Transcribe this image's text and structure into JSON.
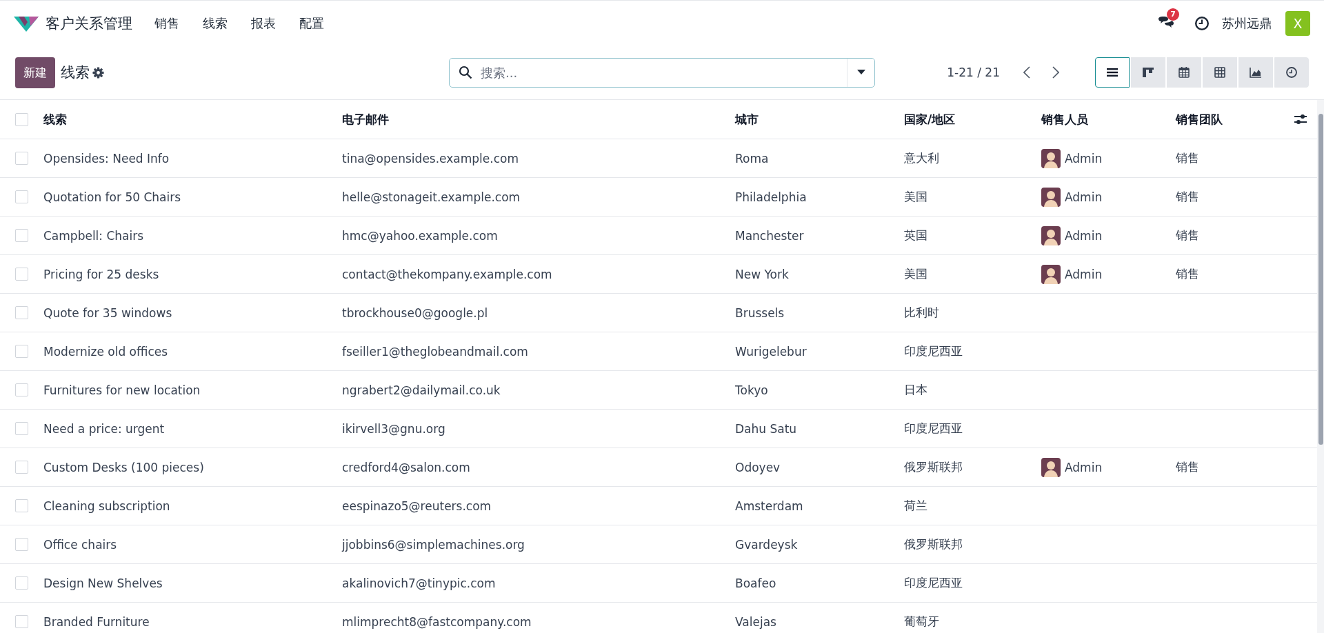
{
  "navbar": {
    "app_name": "客户关系管理",
    "menu": [
      "销售",
      "线索",
      "报表",
      "配置"
    ],
    "messages_badge": "7",
    "company": "苏州远鼎",
    "user_initial": "X"
  },
  "control_panel": {
    "new_button": "新建",
    "breadcrumb": "线索",
    "search": {
      "placeholder": "搜索..."
    },
    "pager": "1-21 / 21",
    "views": [
      {
        "kind": "list",
        "selected": true
      },
      {
        "kind": "kanban",
        "selected": false
      },
      {
        "kind": "calendar",
        "selected": false
      },
      {
        "kind": "pivot",
        "selected": false
      },
      {
        "kind": "graph",
        "selected": false
      },
      {
        "kind": "activity",
        "selected": false
      }
    ]
  },
  "table": {
    "select_all": {
      "checked": false
    },
    "columns": [
      "线索",
      "电子邮件",
      "城市",
      "国家/地区",
      "销售人员",
      "销售团队"
    ],
    "rows": [
      {
        "name": "Opensides: Need Info",
        "email": "tina@opensides.example.com",
        "city": "Roma",
        "country": "意大利",
        "salesperson": "Admin",
        "team": "销售",
        "checked": false
      },
      {
        "name": "Quotation for 50 Chairs",
        "email": "helle@stonageit.example.com",
        "city": "Philadelphia",
        "country": "美国",
        "salesperson": "Admin",
        "team": "销售",
        "checked": false
      },
      {
        "name": "Campbell: Chairs",
        "email": "hmc@yahoo.example.com",
        "city": "Manchester",
        "country": "英国",
        "salesperson": "Admin",
        "team": "销售",
        "checked": false
      },
      {
        "name": "Pricing for 25 desks",
        "email": "contact@thekompany.example.com",
        "city": "New York",
        "country": "美国",
        "salesperson": "Admin",
        "team": "销售",
        "checked": false
      },
      {
        "name": "Quote for 35 windows",
        "email": "tbrockhouse0@google.pl",
        "city": "Brussels",
        "country": "比利时",
        "checked": false
      },
      {
        "name": "Modernize old offices",
        "email": "fseiller1@theglobeandmail.com",
        "city": "Wurigelebur",
        "country": "印度尼西亚",
        "checked": false
      },
      {
        "name": "Furnitures for new location",
        "email": "ngrabert2@dailymail.co.uk",
        "city": "Tokyo",
        "country": "日本",
        "checked": false
      },
      {
        "name": "Need a price: urgent",
        "email": "ikirvell3@gnu.org",
        "city": "Dahu Satu",
        "country": "印度尼西亚",
        "checked": false
      },
      {
        "name": "Custom Desks (100 pieces)",
        "email": "credford4@salon.com",
        "city": "Odoyev",
        "country": "俄罗斯联邦",
        "salesperson": "Admin",
        "team": "销售",
        "checked": false
      },
      {
        "name": "Cleaning subscription",
        "email": "eespinazo5@reuters.com",
        "city": "Amsterdam",
        "country": "荷兰",
        "checked": false
      },
      {
        "name": "Office chairs",
        "email": "jjobbins6@simplemachines.org",
        "city": "Gvardeysk",
        "country": "俄罗斯联邦",
        "checked": false
      },
      {
        "name": "Design New Shelves",
        "email": "akalinovich7@tinypic.com",
        "city": "Boafeo",
        "country": "印度尼西亚",
        "checked": false
      },
      {
        "name": "Branded Furniture",
        "email": "mlimprecht8@fastcompany.com",
        "city": "Valejas",
        "country": "葡萄牙",
        "checked": false
      }
    ]
  }
}
